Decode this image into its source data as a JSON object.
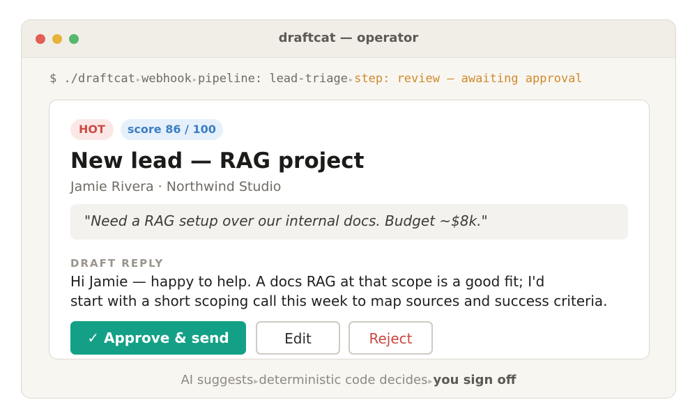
{
  "window": {
    "title": "draftcat — operator"
  },
  "command": {
    "prompt": "$",
    "executable": "./draftcat",
    "trigger": "webhook",
    "pipeline": "pipeline: lead-triage",
    "step": "step: review — awaiting approval",
    "separator": "▸"
  },
  "lead": {
    "badge": "HOT",
    "score": "score 86 / 100",
    "title": "New lead — RAG project",
    "subtitle": "Jamie Rivera · Northwind Studio",
    "quote": "\"Need a RAG setup over our internal docs. Budget ~$8k.\""
  },
  "draft": {
    "label": "DRAFT REPLY",
    "line1": "Hi Jamie — happy to help. A docs RAG at that scope is a good fit; I'd",
    "line2": "start with a short scoping call this week to map sources and success criteria."
  },
  "actions": {
    "approve": "✓ Approve & send",
    "edit": "Edit",
    "reject": "Reject"
  },
  "footer": {
    "part1": "AI suggests",
    "part2": "deterministic code decides",
    "part3": "you sign off",
    "separator": "▸"
  },
  "colors": {
    "accent": "#13a086",
    "hot": "#cc4b44",
    "score": "#3d7fc3",
    "step": "#cf8a2c",
    "window_bg": "#f8f6f1"
  }
}
